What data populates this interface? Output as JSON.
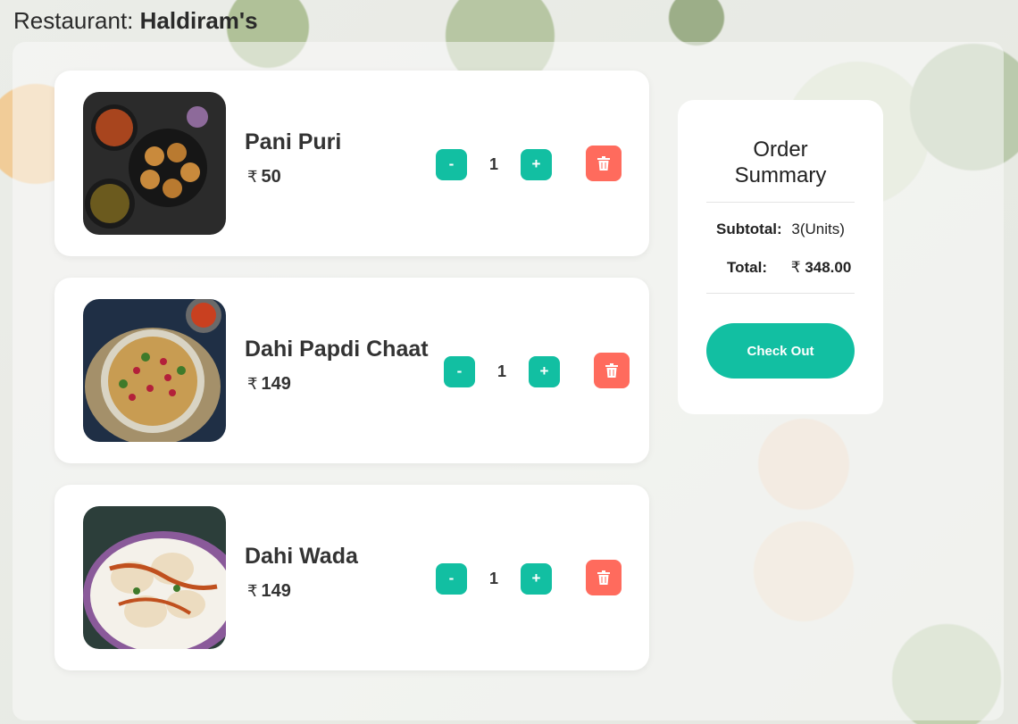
{
  "header": {
    "prefix": "Restaurant:",
    "restaurant_name": "Haldiram's"
  },
  "currency_symbol": "₹",
  "cart": {
    "items": [
      {
        "name": "Pani Puri",
        "price": "50",
        "quantity": "1",
        "decrement": "-",
        "increment": "+",
        "image": "pani-puri-image"
      },
      {
        "name": "Dahi Papdi Chaat",
        "price": "149",
        "quantity": "1",
        "decrement": "-",
        "increment": "+",
        "image": "dahi-papdi-chaat-image"
      },
      {
        "name": "Dahi Wada",
        "price": "149",
        "quantity": "1",
        "decrement": "-",
        "increment": "+",
        "image": "dahi-wada-image"
      }
    ],
    "delete_icon": "trash-icon"
  },
  "summary": {
    "title": "Order Summary",
    "subtotal_label": "Subtotal:",
    "subtotal_value": "3(Units)",
    "total_label": "Total:",
    "total_value": "348.00",
    "checkout_label": "Check Out"
  },
  "colors": {
    "accent": "#12bfa2",
    "delete": "#ff6b5d"
  }
}
